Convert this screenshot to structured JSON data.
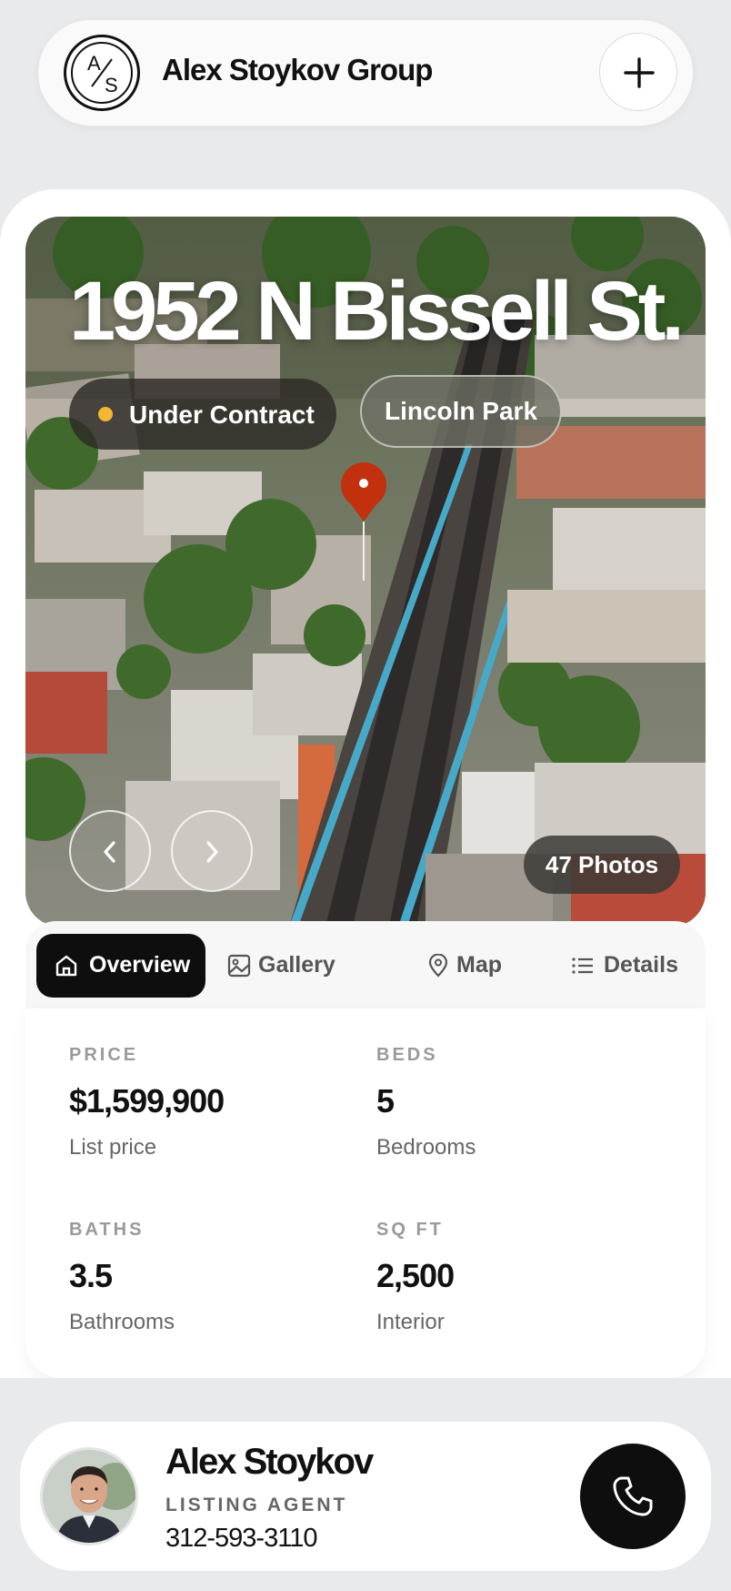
{
  "header": {
    "logo_letters": "A/S",
    "brand": "Alex Stoykov Group"
  },
  "listing": {
    "address": "1952 N Bissell St.",
    "status": "Under Contract",
    "status_color": "#f4b731",
    "neighborhood": "Lincoln Park",
    "photos_label": "47 Photos"
  },
  "tabs": [
    {
      "label": "Overview",
      "icon": "home-icon",
      "active": true
    },
    {
      "label": "Gallery",
      "icon": "image-icon",
      "active": false
    },
    {
      "label": "Map",
      "icon": "map-pin-icon",
      "active": false
    },
    {
      "label": "Details",
      "icon": "list-icon",
      "active": false
    }
  ],
  "stats": [
    {
      "key": "PRICE",
      "value": "$1,599,900",
      "sub": "List price"
    },
    {
      "key": "BEDS",
      "value": "5",
      "sub": "Bedrooms"
    },
    {
      "key": "BATHS",
      "value": "3.5",
      "sub": "Bathrooms"
    },
    {
      "key": "SQ FT",
      "value": "2,500",
      "sub": "Interior"
    }
  ],
  "agent": {
    "name": "Alex Stoykov",
    "role": "LISTING AGENT",
    "phone": "312-593-3110"
  }
}
